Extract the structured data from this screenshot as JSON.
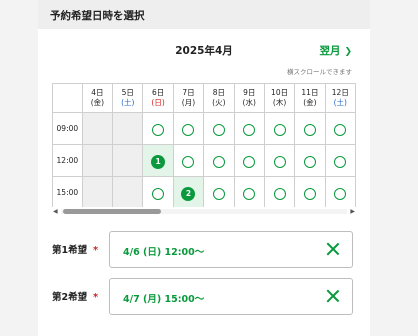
{
  "header": {
    "title": "予約希望日時を選択"
  },
  "calendar": {
    "month_title": "2025年4月",
    "next_month_label": "翌月",
    "scroll_note": "横スクロールできます",
    "days": [
      {
        "date": "4日",
        "weekday": "(金)",
        "type": "weekday"
      },
      {
        "date": "5日",
        "weekday": "(土)",
        "type": "sat"
      },
      {
        "date": "6日",
        "weekday": "(日)",
        "type": "sun"
      },
      {
        "date": "7日",
        "weekday": "(月)",
        "type": "weekday"
      },
      {
        "date": "8日",
        "weekday": "(火)",
        "type": "weekday"
      },
      {
        "date": "9日",
        "weekday": "(水)",
        "type": "weekday"
      },
      {
        "date": "10日",
        "weekday": "(木)",
        "type": "weekday"
      },
      {
        "date": "11日",
        "weekday": "(金)",
        "type": "weekday"
      },
      {
        "date": "12日",
        "weekday": "(土)",
        "type": "sat"
      }
    ],
    "times": [
      "09:00",
      "12:00",
      "15:00"
    ],
    "slots": [
      [
        "closed",
        "closed",
        "open",
        "open",
        "open",
        "open",
        "open",
        "open",
        "open"
      ],
      [
        "closed",
        "closed",
        "choice-1",
        "open",
        "open",
        "open",
        "open",
        "open",
        "open"
      ],
      [
        "closed",
        "closed",
        "open",
        "choice-2",
        "open",
        "open",
        "open",
        "open",
        "open"
      ]
    ],
    "choice_badges": {
      "choice-1": "1",
      "choice-2": "2"
    },
    "scroll_position": 0.0
  },
  "choices": [
    {
      "label": "第1希望",
      "required_mark": "*",
      "value": "4/6 (日) 12:00〜"
    },
    {
      "label": "第2希望",
      "required_mark": "*",
      "value": "4/7 (月) 15:00〜"
    }
  ],
  "colors": {
    "accent": "#0a9a3d",
    "sunday": "#d42020",
    "saturday": "#2266cc",
    "closed": "#efefef",
    "selected": "#e3f5e8"
  }
}
